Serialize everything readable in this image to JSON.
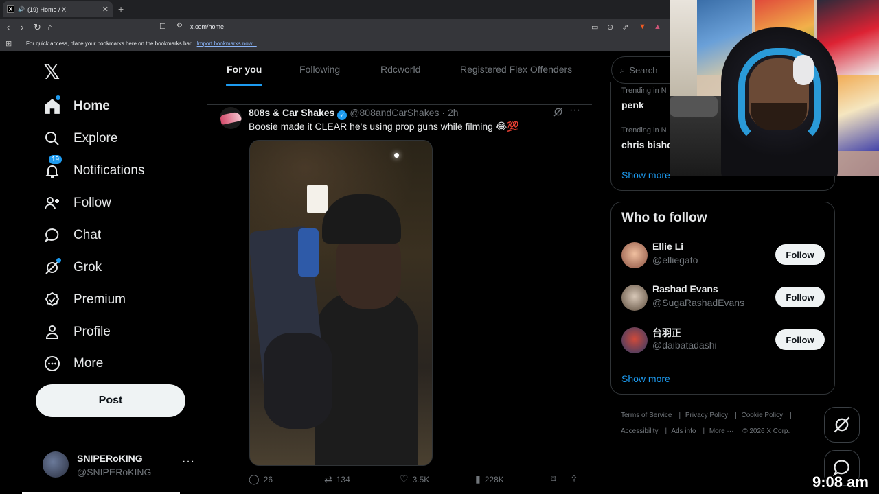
{
  "browser": {
    "tab_title": "(19) Home / X",
    "url": "x.com/home",
    "bookmarks_msg": "For quick access, place your bookmarks here on the bookmarks bar.",
    "bookmarks_link": "Import bookmarks now..."
  },
  "nav": {
    "items": [
      {
        "label": "Home"
      },
      {
        "label": "Explore"
      },
      {
        "label": "Notifications"
      },
      {
        "label": "Follow"
      },
      {
        "label": "Chat"
      },
      {
        "label": "Grok"
      },
      {
        "label": "Premium"
      },
      {
        "label": "Profile"
      },
      {
        "label": "More"
      }
    ],
    "notif_badge": "19",
    "post_label": "Post"
  },
  "account": {
    "name": "SNIPERoKING",
    "handle": "@SNIPERoKING"
  },
  "feed_tabs": [
    "For you",
    "Following",
    "Rdcworld",
    "Registered Flex Offenders"
  ],
  "tweet": {
    "name": "808s & Car Shakes",
    "handle": "@808andCarShakes · 2h",
    "text": "Boosie made it CLEAR he's using prop guns while filming 😂💯",
    "replies": "26",
    "reposts": "134",
    "likes": "3.5K",
    "views": "228K"
  },
  "search_placeholder": "Search",
  "trends": [
    {
      "meta": "Trending in N",
      "name": "penk"
    },
    {
      "meta": "Trending in N",
      "name": "chris bisho"
    }
  ],
  "trends_show_more": "Show more",
  "who_to_follow": {
    "title": "Who to follow",
    "users": [
      {
        "name": "Ellie Li",
        "handle": "@elliegato",
        "button": "Follow"
      },
      {
        "name": "Rashad Evans",
        "handle": "@SugaRashadEvans",
        "button": "Follow"
      },
      {
        "name": "台羽正",
        "handle": "@daibatadashi",
        "button": "Follow"
      }
    ],
    "show_more": "Show more"
  },
  "footer": {
    "links": [
      "Terms of Service",
      "Privacy Policy",
      "Cookie Policy",
      "Accessibility",
      "Ads info",
      "More ···"
    ],
    "copyright": "© 2026 X Corp."
  },
  "clock": "9:08 am",
  "colors": {
    "accent": "#1d9bf0",
    "bg": "#000000",
    "text": "#e7e9ea",
    "muted": "#71767b"
  }
}
